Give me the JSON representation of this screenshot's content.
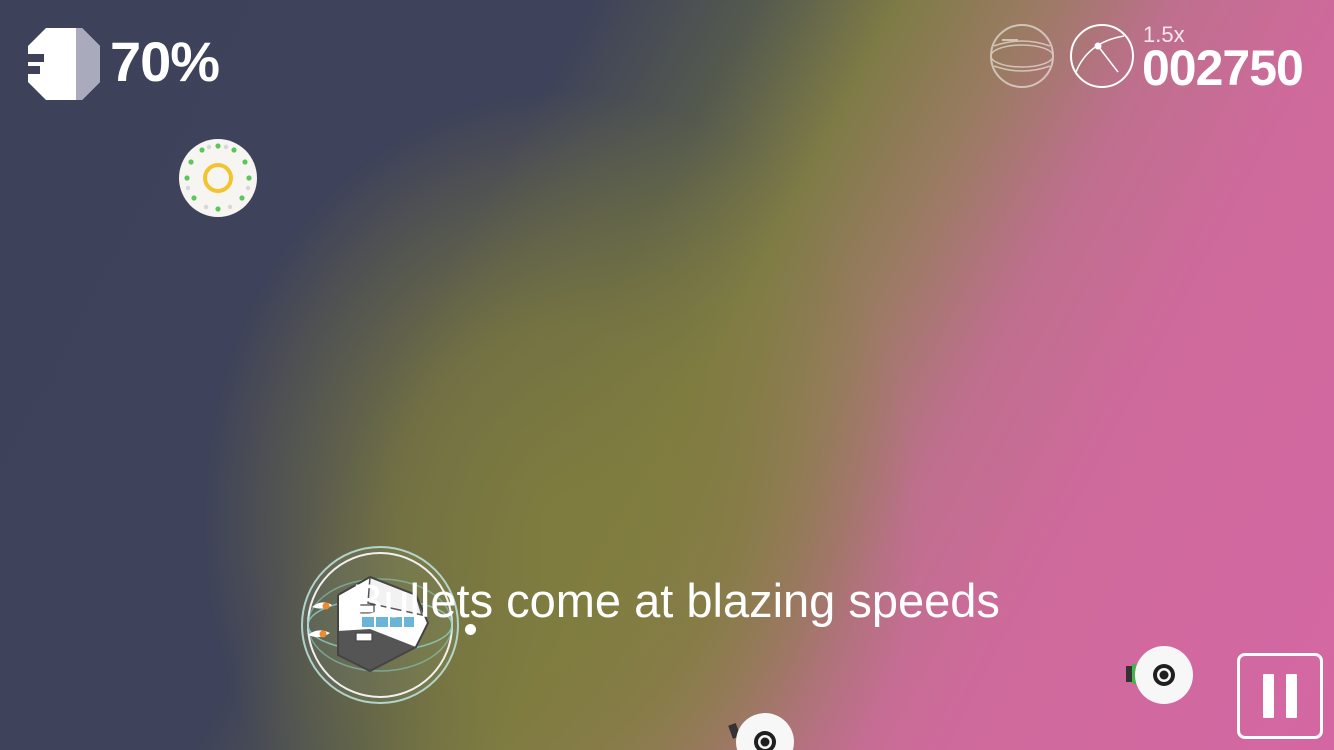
{
  "hud": {
    "fuel_percent_text": "70%",
    "fuel_level": 0.7,
    "fuel_icon": "fuel-gauge-icon",
    "shield_icon": "shield-sphere-icon",
    "timer_icon": "clock-orb-icon",
    "multiplier": "1.5x",
    "score": "002750"
  },
  "tutorial_text": "Bullets come at blazing speeds",
  "objects": {
    "powerup_icon": "orbit-ring-powerup-icon",
    "player_icon": "spaceship-icon",
    "enemy_icon": "eye-turret-icon",
    "bullet_icon": "bullet-dot-icon"
  },
  "controls": {
    "pause_icon": "pause-icon"
  },
  "colors": {
    "bg_dark": "#3e4159",
    "bg_olive": "#7e7b46",
    "bg_pink": "#d467a3",
    "powerup_ring": "#f4c430",
    "powerup_dots": "#5cc65c",
    "enemy_accent": "#4caf50"
  }
}
